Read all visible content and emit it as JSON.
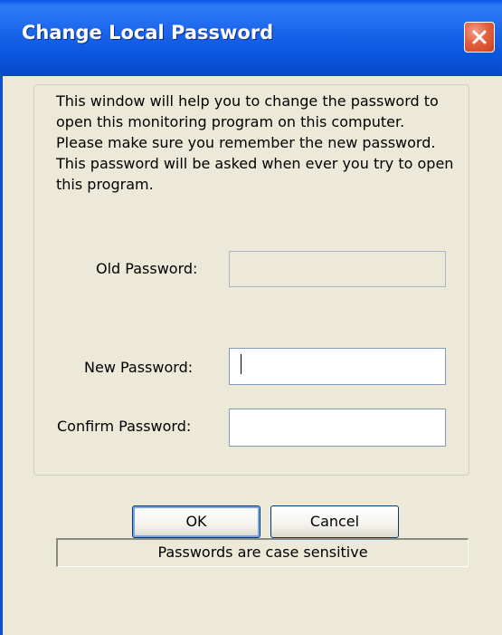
{
  "window": {
    "title": "Change Local Password",
    "close_icon": "close-icon"
  },
  "info": {
    "text": "This window will help you to change the password to open this monitoring program on this computer. Please make sure you remember the new password. This password will be asked when ever you try to open this program."
  },
  "fields": {
    "old_password": {
      "label": "Old Password:",
      "value": "",
      "enabled": false
    },
    "new_password": {
      "label": "New Password:",
      "value": "",
      "focused": true
    },
    "confirm_password": {
      "label": "Confirm Password:",
      "value": ""
    }
  },
  "buttons": {
    "ok": "OK",
    "cancel": "Cancel"
  },
  "status": {
    "text": "Passwords are case sensitive"
  },
  "colors": {
    "titlebar": "#0a58e6",
    "close_button": "#e2603e",
    "window_bg": "#ece9d8",
    "input_border": "#7f9db9"
  }
}
